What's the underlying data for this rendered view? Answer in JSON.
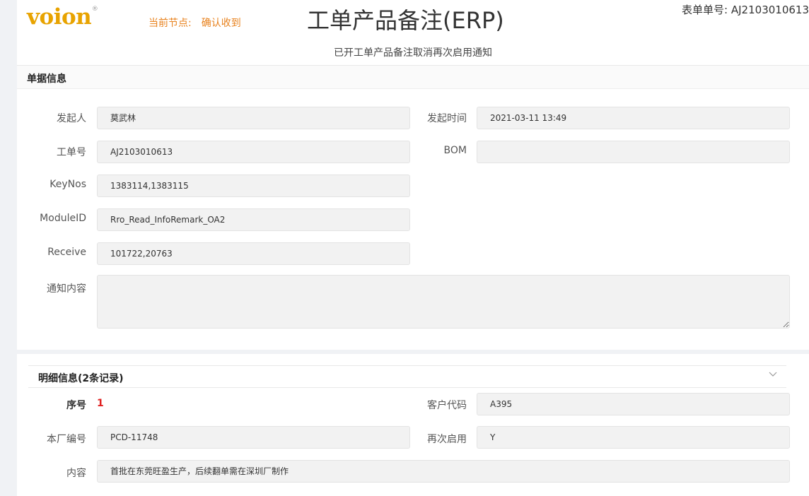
{
  "header": {
    "logo": "voion",
    "logo_mark": "®",
    "node_label": "当前节点:",
    "node_value": "确认收到",
    "title": "工单产品备注(ERP)",
    "form_no_label": "表单单号:",
    "form_no_value": "AJ2103010613",
    "subtitle": "已开工单产品备注取消再次启用通知"
  },
  "doc_info": {
    "section_title": "单据信息",
    "initiator_label": "发起人",
    "initiator_value": "莫武林",
    "initiate_time_label": "发起时间",
    "initiate_time_value": "2021-03-11 13:49",
    "work_order_label": "工单号",
    "work_order_value": "AJ2103010613",
    "bom_label": "BOM",
    "bom_value": "",
    "keynos_label": "KeyNos",
    "keynos_value": "1383114,1383115",
    "module_label": "ModuleID",
    "module_value": "Rro_Read_InfoRemark_OA2",
    "receive_label": "Receive",
    "receive_value": "101722,20763",
    "notice_label": "通知内容",
    "notice_value": ""
  },
  "details": {
    "section_title": "明细信息(2条记录)",
    "seq_label": "序号",
    "seq_value": "1",
    "customer_code_label": "客户代码",
    "customer_code_value": "A395",
    "factory_no_label": "本厂编号",
    "factory_no_value": "PCD-11748",
    "reenable_label": "再次启用",
    "reenable_value": "Y",
    "content_label": "内容",
    "content_value": "首批在东莞旺盈生产，后续翻单需在深圳厂制作"
  },
  "colors": {
    "logo": "#e8a300",
    "node": "#e8821e",
    "seq": "#e02020",
    "field_bg": "#f2f2f2"
  },
  "icons": {
    "collapse": "chevron-down-icon"
  }
}
